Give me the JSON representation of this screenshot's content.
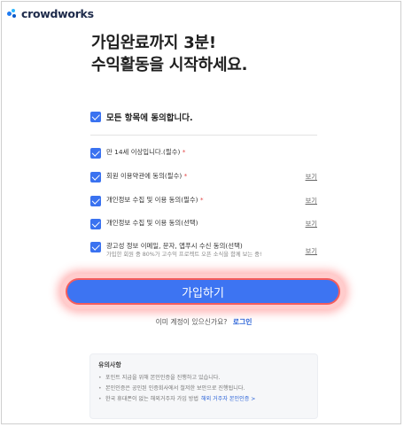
{
  "brand": {
    "name": "crowdworks"
  },
  "headline": {
    "line1": "가입완료까지 3분!",
    "line2": "수익활동을 시작하세요."
  },
  "agree_all": {
    "label": "모든 항목에 동의합니다.",
    "checked": true
  },
  "terms": [
    {
      "text": "만 14세 이상입니다.(필수)",
      "required_mark": "*",
      "view": "",
      "checked": true
    },
    {
      "text": "회원 이용약관에 동의(필수)",
      "required_mark": "*",
      "view": "보기",
      "checked": true
    },
    {
      "text": "개인정보 수집 및 이용 동의(필수)",
      "required_mark": "*",
      "view": "보기",
      "checked": true
    },
    {
      "text": "개인정보 수집 및 이용 동의(선택)",
      "required_mark": "",
      "view": "보기",
      "checked": true
    },
    {
      "text": "광고성 정보 이메일, 문자, 앱푸시 수신 동의(선택)",
      "required_mark": "",
      "sub": "가입한 회원 중 80%가 고수익 프로젝트 오픈 소식을 함께 보는 중!",
      "view": "보기",
      "checked": true
    }
  ],
  "join_button": {
    "label": "가입하기"
  },
  "login_prompt": {
    "text": "이미 계정이 있으신가요?",
    "link": "로그인"
  },
  "notice": {
    "title": "유의사항",
    "items": [
      {
        "text": "포인트 지급을 위해 본인인증을 진행하고 있습니다.",
        "link": ""
      },
      {
        "text": "본인인증은 공인된 인증회사에서 철저한 보안으로 진행됩니다.",
        "link": ""
      },
      {
        "text": "한국 휴대폰이 없는 해외거주자 가입 방법",
        "link": "해외 거주자 본인인증 >"
      }
    ]
  },
  "colors": {
    "accent": "#3d74f2",
    "highlight": "#f45c5c",
    "link": "#2c64d8"
  }
}
